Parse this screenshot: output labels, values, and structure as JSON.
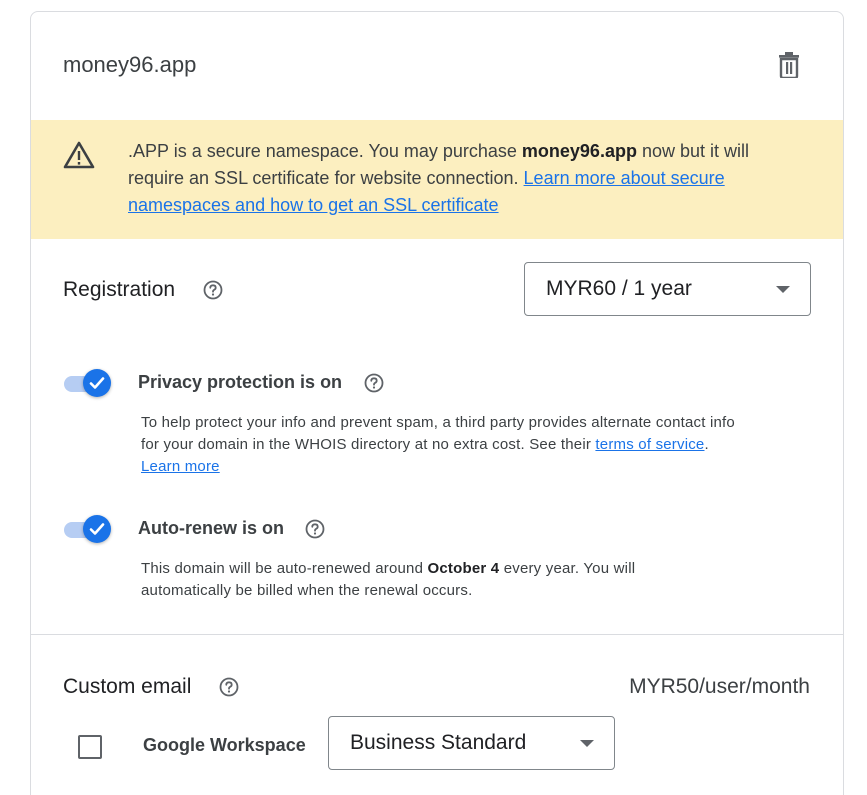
{
  "domain": {
    "name": "money96.app"
  },
  "warning": {
    "text_before": ".APP is a secure namespace. You may purchase ",
    "domain_bold": "money96.app",
    "text_after": " now but it will require an SSL certificate for website connection. ",
    "link": "Learn more about secure namespaces and how to get an SSL certificate"
  },
  "registration": {
    "label": "Registration",
    "selected_option": "MYR60 / 1 year"
  },
  "privacy": {
    "title": "Privacy protection is on",
    "description": "To help protect your info and prevent spam, a third party provides alternate contact info for your domain in the WHOIS directory at no extra cost. See their ",
    "tos_link": "terms of service",
    "separator": ". ",
    "learn_more_link": "Learn more",
    "enabled": true
  },
  "autorenew": {
    "title": "Auto-renew is on",
    "desc_before": "This domain will be auto-renewed around ",
    "date_bold": "October 4",
    "desc_after": " every year. You will automatically be billed when the renewal occurs.",
    "enabled": true
  },
  "custom_email": {
    "label": "Custom email",
    "price": "MYR50/user/month",
    "workspace_label": "Google Workspace",
    "plan_selected": "Business Standard",
    "checked": false
  },
  "colors": {
    "accent": "#1a73e8",
    "warning_bg": "#fcefc0",
    "toggle_track": "#b6cdf3"
  },
  "icons": [
    "trash-icon",
    "warning-icon",
    "help-icon",
    "check-icon",
    "caret-down-icon"
  ]
}
